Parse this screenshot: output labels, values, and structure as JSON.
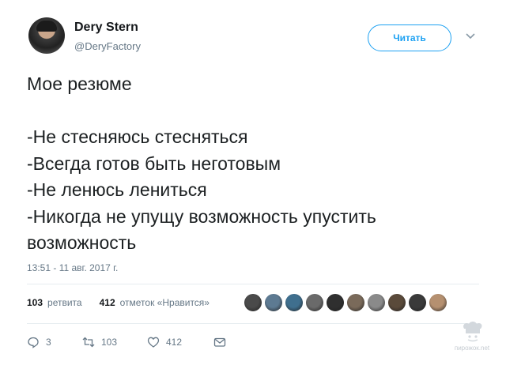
{
  "author": {
    "name": "Dery Stern",
    "handle": "@DeryFactory"
  },
  "follow_button": {
    "label": "Читать"
  },
  "tweet": {
    "text": "Мое резюме\n\n-Не стесняюсь стесняться\n-Всегда готов быть неготовым\n-Не ленюсь лениться\n-Никогда не упущу возможность упустить\nвозможность",
    "timestamp": "13:51 - 11 авг. 2017 г."
  },
  "stats": {
    "retweets_count": "103",
    "retweets_label": "ретвита",
    "likes_count": "412",
    "likes_label": "отметок «Нравится»"
  },
  "likers": {
    "colors": [
      "#4a4a4a",
      "#5d7a92",
      "#3f6f8e",
      "#6a6a6a",
      "#2f2f2f",
      "#7a6a5a",
      "#8a8a8a",
      "#5a4a3a",
      "#3a3a3a",
      "#b59070"
    ]
  },
  "actions": {
    "reply_count": "3",
    "retweet_count": "103",
    "like_count": "412"
  },
  "icons": {
    "chevron": "chevron-down-icon",
    "reply": "reply-icon",
    "retweet": "retweet-icon",
    "like": "heart-icon",
    "dm": "envelope-icon"
  },
  "colors": {
    "accent": "#1da1f2",
    "muted": "#657786",
    "divider": "#e6ecf0"
  },
  "watermark": {
    "text": "пирожок.net"
  }
}
